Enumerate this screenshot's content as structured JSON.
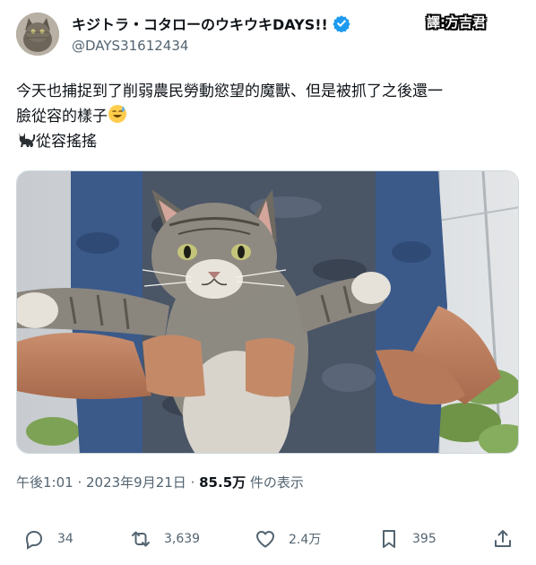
{
  "user": {
    "display_name": "キジトラ・コタローのウキウキDAYS!!",
    "handle": "@DAYS31612434"
  },
  "watermark": "譯:方吉君",
  "tweet": {
    "line1": "今天也捕捉到了削弱農民勞動慾望的魔獸、但是被抓了之後還一",
    "line2": "臉從容的樣子",
    "line3": "從容搖搖"
  },
  "meta": {
    "time": "午後1:01",
    "dot1": " · ",
    "date": "2023年9月21日",
    "dot2": " · ",
    "views_count": "85.5万",
    "views_label": " 件の表示"
  },
  "actions": {
    "replies": "34",
    "retweets": "3,639",
    "likes": "2.4万",
    "bookmarks": "395"
  },
  "icons": {
    "verified": "verified-badge-icon",
    "reply": "reply-icon",
    "retweet": "retweet-icon",
    "like": "heart-icon",
    "bookmark": "bookmark-icon",
    "share": "share-icon"
  },
  "colors": {
    "verified": "#1d9bf0",
    "secondary_text": "#536471",
    "text": "#0f1419"
  }
}
